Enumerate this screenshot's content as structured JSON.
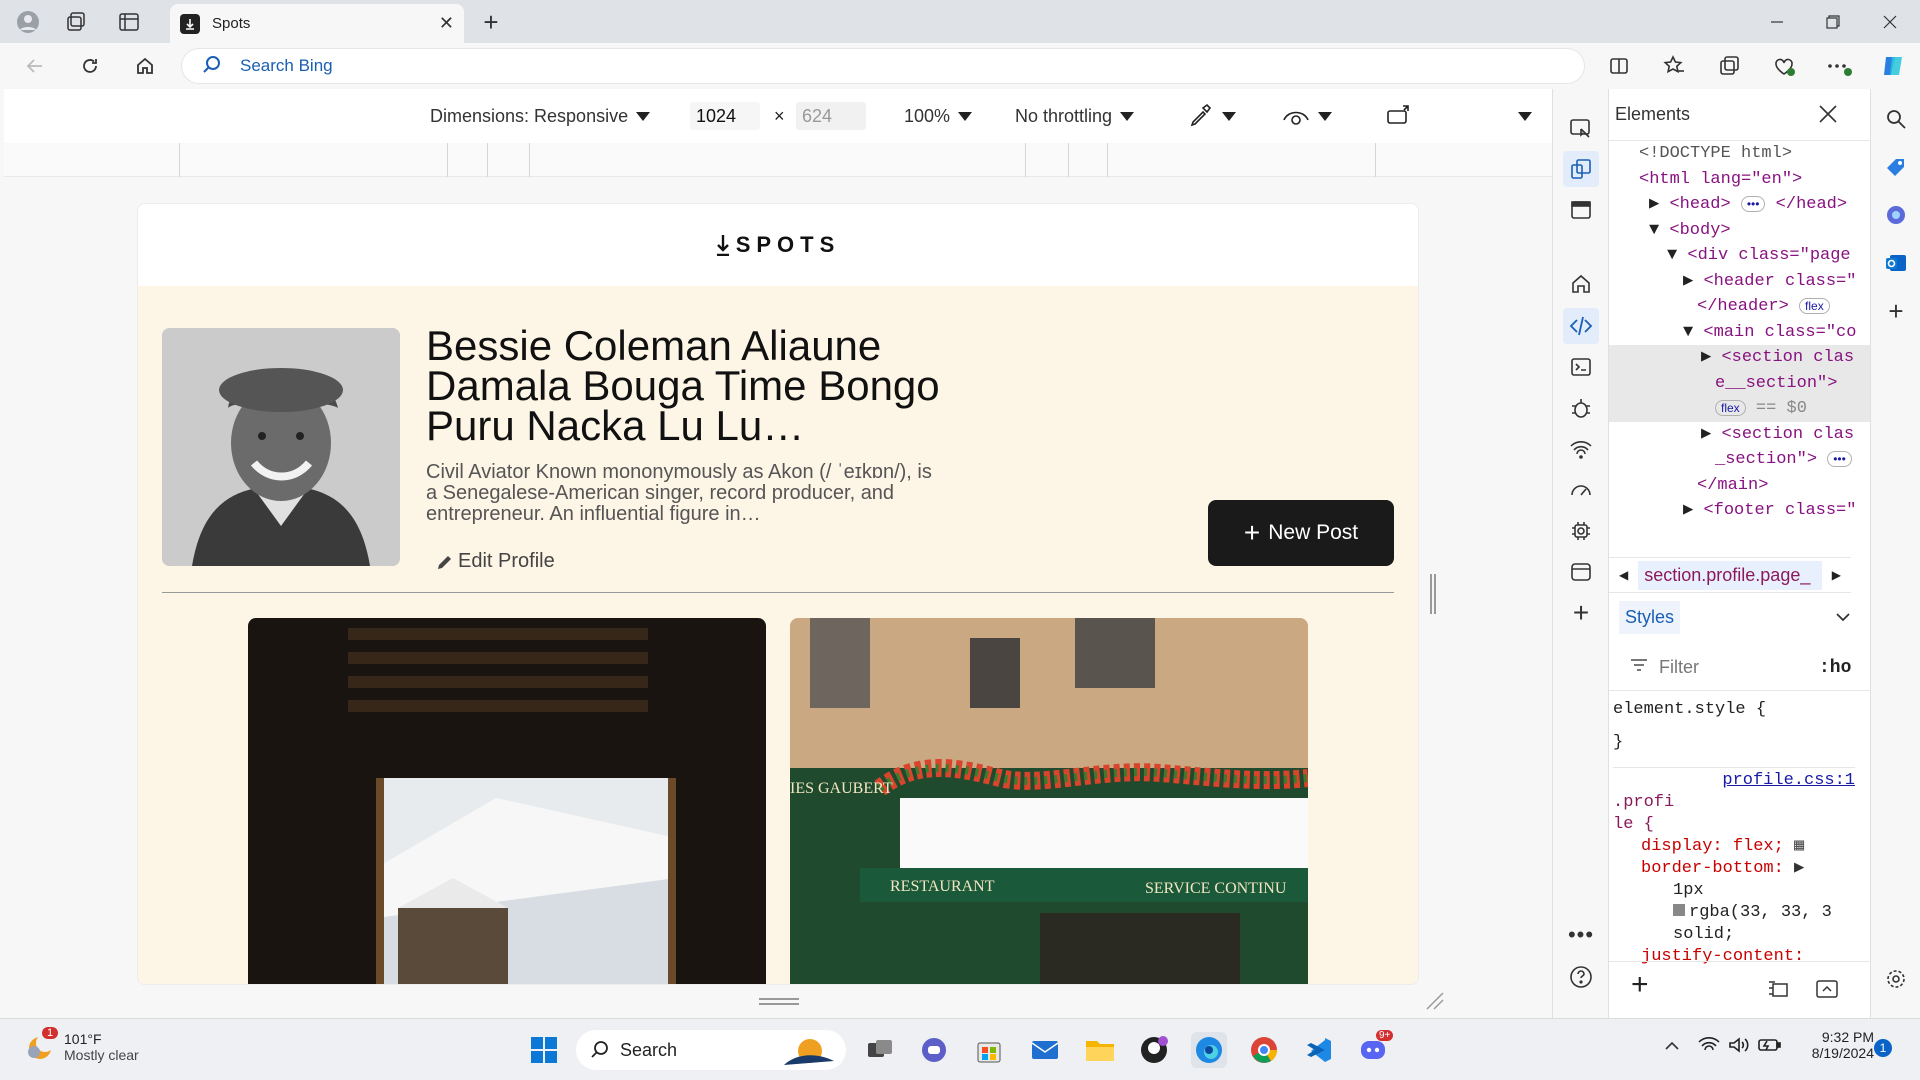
{
  "browser": {
    "tab_title": "Spots",
    "address_placeholder": "Search Bing"
  },
  "device_toolbar": {
    "dimensions_label": "Dimensions: Responsive",
    "width": "1024",
    "height": "624",
    "zoom": "100%",
    "throttling": "No throttling"
  },
  "site": {
    "logo_text": "SPOTS",
    "profile": {
      "name": "Bessie Coleman Aliaune Damala Bouga Time Bongo Puru Nacka Lu Lu…",
      "bio": "Civil Aviator Known mononymously as Akon (/ ˈeɪkɒn/), is a Senegalese-American singer, record producer, and entrepreneur. An influential figure in…",
      "edit_label": "Edit Profile"
    },
    "new_post_label": "New Post",
    "cards": [
      {
        "alt": "Snowy mountain hotel seen through a window"
      },
      {
        "alt": "Parisian restaurant facade with flowers",
        "sign_left": "RESTAURANT",
        "sign_right": "SERVICE CONTINU",
        "awning": "IES GAUBERT"
      }
    ]
  },
  "devtools": {
    "panel_title": "Elements",
    "dom_lines": [
      "<!DOCTYPE html>",
      "<html lang=\"en\">",
      "<head>",
      "<body>",
      "<div class=\"page",
      "<header class=\"",
      "</header>",
      "<main class=\"co",
      "<section clas",
      "e__section\">",
      "== $0",
      "<section clas",
      "_section\">",
      "</main>",
      "<footer class=\""
    ],
    "pill_flex": "flex",
    "breadcrumb": "section.profile.page_",
    "styles_tab": "Styles",
    "filter_placeholder": "Filter",
    "hov": ":ho",
    "css": {
      "element_style": "element.style {",
      "close_brace": "}",
      "source_link": "profile.css:1",
      "selector_1": ".profi",
      "selector_2": "le {",
      "p1": "display: flex;",
      "p2": "border-bottom:",
      "p3": "1px",
      "p4": "rgba(33, 33, 3",
      "p5": "solid;",
      "p6": "justify-content:"
    }
  },
  "taskbar": {
    "weather_temp": "101°F",
    "weather_desc": "Mostly clear",
    "weather_badge": "1",
    "search_label": "Search",
    "time": "9:32 PM",
    "date": "8/19/2024",
    "notif_count": "1",
    "discord_badge": "9+"
  }
}
